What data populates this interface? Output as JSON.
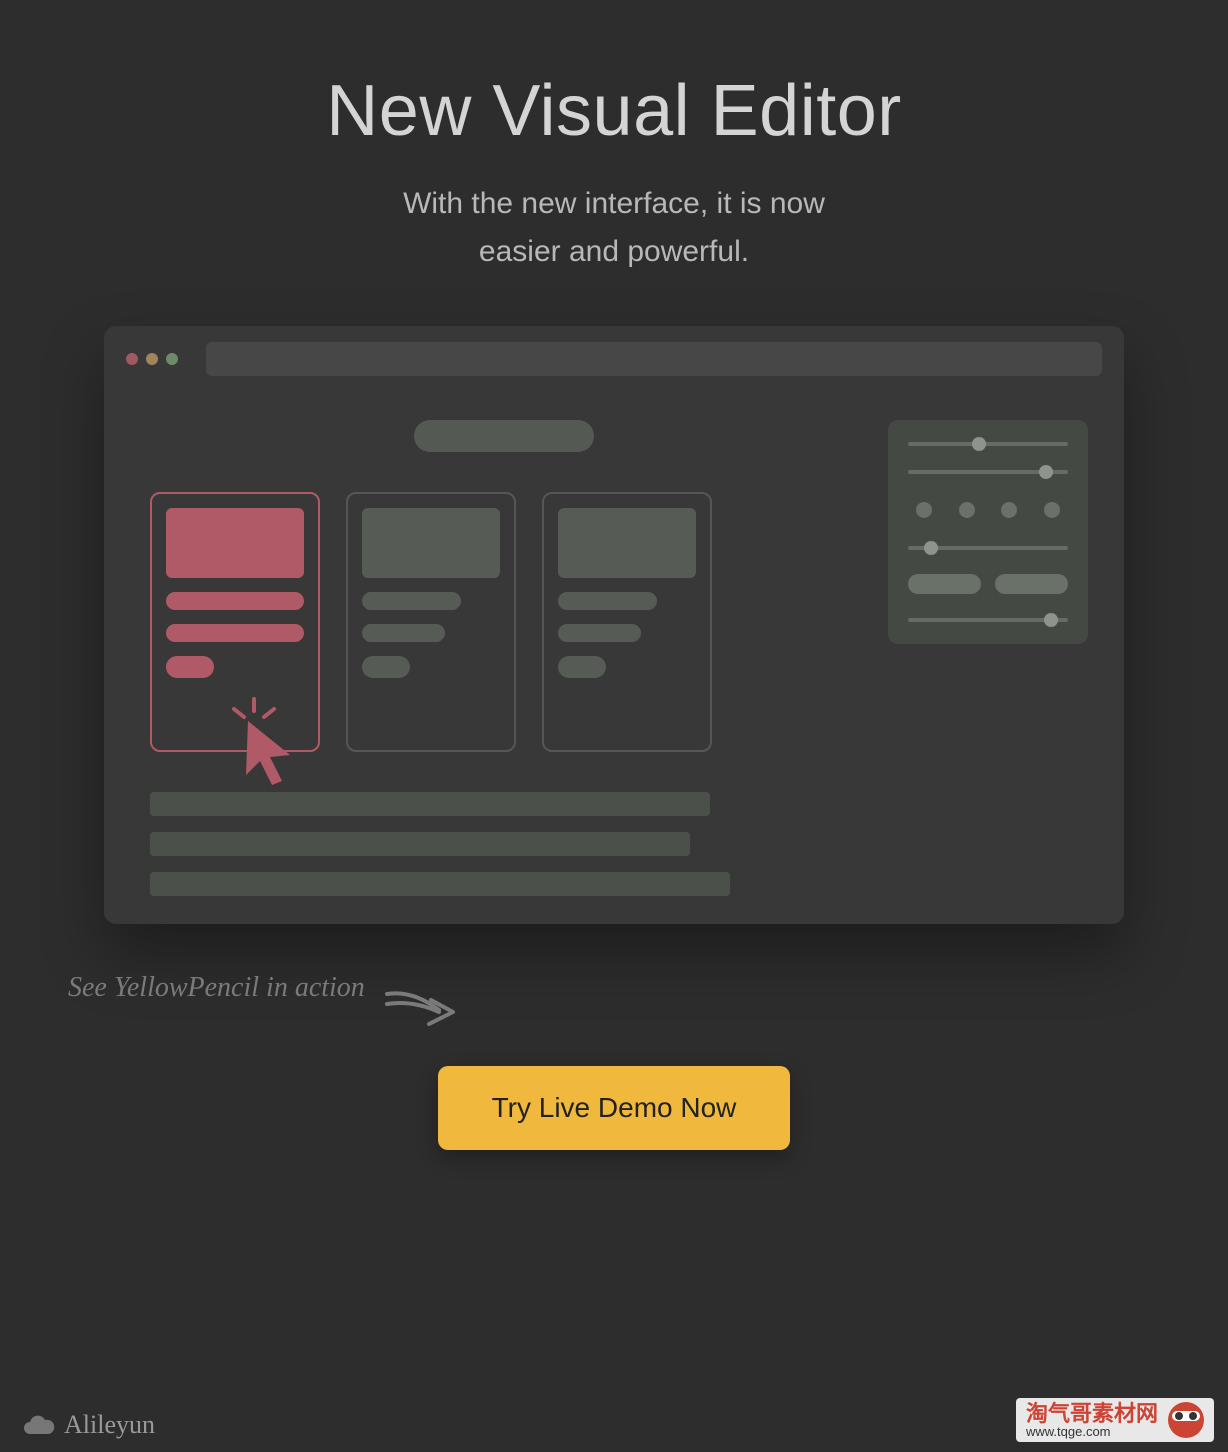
{
  "hero": {
    "title": "New Visual Editor",
    "subtitle_line1": "With the new interface, it is now",
    "subtitle_line2": "easier and powerful."
  },
  "caption": "See YellowPencil in action",
  "cta_label": "Try Live Demo Now",
  "footer": {
    "left_brand": "Alileyun",
    "right_cn": "淘气哥素材网",
    "right_url": "www.tqge.com"
  },
  "colors": {
    "accent": "#b05a67",
    "cta": "#f0b93e"
  }
}
